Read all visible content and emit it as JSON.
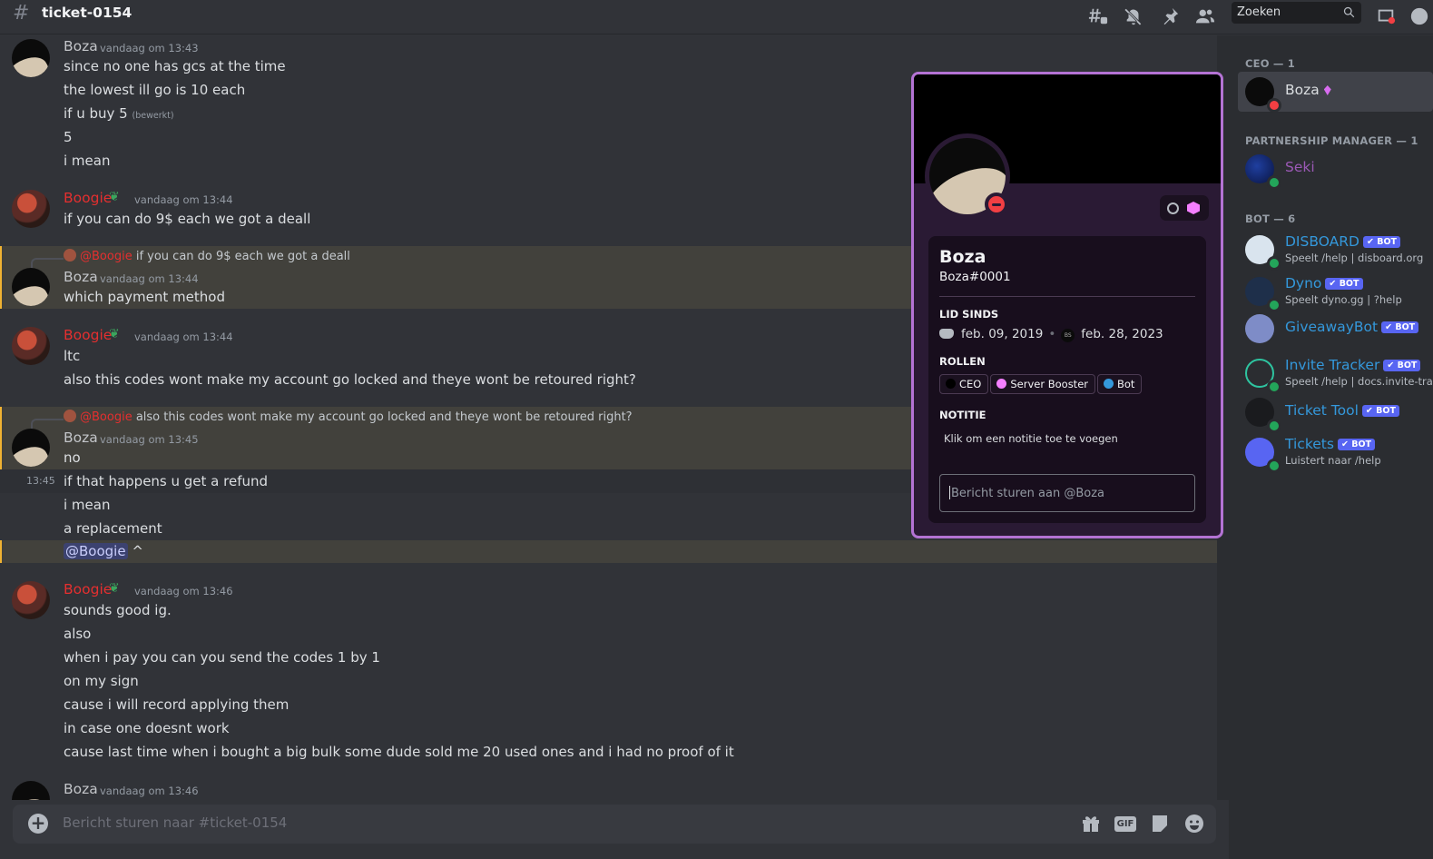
{
  "header": {
    "channel_hash": "#",
    "channel_name": "ticket-0154",
    "search_placeholder": "Zoeken"
  },
  "messages": {
    "g1": {
      "author": "Boza",
      "timestamp": "vandaag om 13:43",
      "lines": [
        "since no one has gcs at the time",
        "the lowest ill go is 10 each",
        "if u buy 5",
        "5",
        "i mean"
      ],
      "edited": "(bewerkt)"
    },
    "g2": {
      "author": "Boogie",
      "timestamp": "vandaag om 13:44",
      "lines": [
        "if you can do 9$ each we got a deall"
      ]
    },
    "g3": {
      "reply_mention": "@Boogie",
      "reply_text": "if you can do 9$ each we got a deall",
      "author": "Boza",
      "timestamp": "vandaag om 13:44",
      "lines": [
        "which payment method"
      ]
    },
    "g4": {
      "author": "Boogie",
      "timestamp": "vandaag om 13:44",
      "lines": [
        "ltc",
        "also this codes wont make my account go locked and theye wont be retoured right?"
      ]
    },
    "g5": {
      "reply_mention": "@Boogie",
      "reply_text": "also this codes wont make my account go locked and theye wont be retoured right?",
      "author": "Boza",
      "timestamp": "vandaag om 13:45",
      "lines": [
        "no",
        "if that happens u get a refund",
        "i mean",
        "a replacement"
      ],
      "hover_time": "13:45",
      "mention": "@Boogie",
      "mention_tail": " ^"
    },
    "g6": {
      "author": "Boogie",
      "timestamp": "vandaag om 13:46",
      "lines": [
        "sounds good ig.",
        "also",
        "when i pay you can you send the codes 1 by 1",
        "on my sign",
        "cause i will record applying them",
        "in case one doesnt work",
        "cause last time when i bought a big bulk some dude sold me 20 used ones and i had no proof of it"
      ]
    },
    "g7": {
      "author": "Boza",
      "timestamp": "vandaag om 13:46"
    }
  },
  "composer": {
    "placeholder": "Bericht sturen naar #ticket-0154",
    "gif_label": "GIF"
  },
  "members": {
    "groups": [
      {
        "title": "CEO — 1"
      },
      {
        "title": "PARTNERSHIP MANAGER — 1"
      },
      {
        "title": "BOT — 6"
      }
    ],
    "list": [
      {
        "name": "Boza",
        "color": "#dbdee1",
        "status": "dnd"
      },
      {
        "name": "Seki",
        "color": "#9b59b6",
        "status": "online"
      },
      {
        "name": "DISBOARD",
        "color": "#3498db",
        "badge": "✔ BOT",
        "activity": "Speelt /help | disboard.org"
      },
      {
        "name": "Dyno",
        "color": "#3498db",
        "badge": "✔ BOT",
        "activity": "Speelt dyno.gg | ?help"
      },
      {
        "name": "GiveawayBot",
        "color": "#3498db",
        "badge": "✔ BOT"
      },
      {
        "name": "Invite Tracker",
        "color": "#3498db",
        "badge": "✔ BOT",
        "activity": "Speelt /help | docs.invite-tra..."
      },
      {
        "name": "Ticket Tool",
        "color": "#3498db",
        "badge": "✔ BOT"
      },
      {
        "name": "Tickets",
        "color": "#3498db",
        "badge": "✔ BOT",
        "activity": "Luistert naar /help"
      }
    ]
  },
  "profile": {
    "display_name": "Boza",
    "tag": "Boza#0001",
    "member_since_label": "LID SINDS",
    "discord_date": "feb. 09, 2019",
    "server_date": "feb. 28, 2023",
    "server_abbr": "BS",
    "roles_label": "ROLLEN",
    "roles": [
      {
        "name": "CEO",
        "color": "#000000"
      },
      {
        "name": "Server Booster",
        "color": "#f47fff"
      },
      {
        "name": "Bot",
        "color": "#3498db"
      }
    ],
    "note_label": "NOTITIE",
    "note_placeholder": "Klik om een notitie toe te voegen",
    "message_placeholder": "Bericht sturen aan @Boza"
  },
  "colors": {
    "background": "#313338",
    "sidebar": "#2b2d31",
    "boogie_name": "#e52f2f",
    "bot_badge": "#5865f2",
    "profile_border": "#b473d4"
  }
}
